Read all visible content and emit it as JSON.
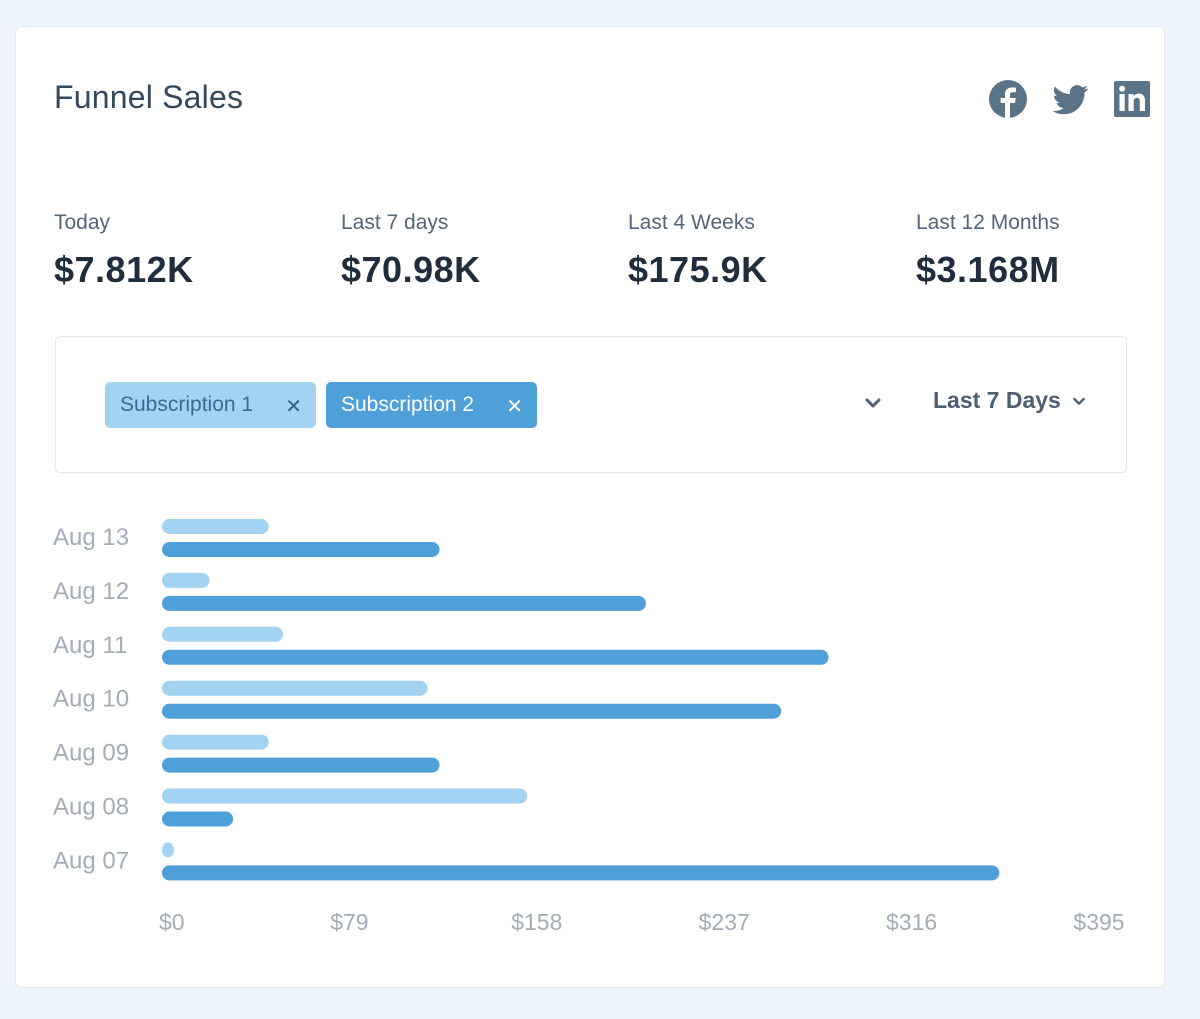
{
  "card": {
    "title": "Funnel Sales",
    "social": [
      {
        "name": "facebook-icon",
        "label": "Facebook"
      },
      {
        "name": "twitter-icon",
        "label": "Twitter"
      },
      {
        "name": "linkedin-icon",
        "label": "LinkedIn"
      }
    ],
    "icon_color": "#5a7386"
  },
  "stats": [
    {
      "label": "Today",
      "value": "$7.812K"
    },
    {
      "label": "Last 7 days",
      "value": "$70.98K"
    },
    {
      "label": "Last 4 Weeks",
      "value": "$175.9K"
    },
    {
      "label": "Last 12 Months",
      "value": "$3.168M"
    }
  ],
  "filter": {
    "tags": [
      {
        "label": "Subscription 1",
        "remove_icon": "close-icon",
        "color": "#a4d2f1"
      },
      {
        "label": "Subscription 2",
        "remove_icon": "close-icon",
        "color": "#4fa0d8"
      }
    ],
    "series_dropdown_icon": "chevron-down-icon",
    "range_label": "Last 7 Days",
    "range_icon": "chevron-down-icon"
  },
  "chart_data": {
    "type": "bar",
    "orientation": "horizontal",
    "title": "",
    "xlabel": "",
    "ylabel": "",
    "categories": [
      "Aug 13",
      "Aug 12",
      "Aug 11",
      "Aug 10",
      "Aug 09",
      "Aug 08",
      "Aug 07"
    ],
    "series": [
      {
        "name": "Subscription 1",
        "color": "#a4d2f1",
        "values": [
          45,
          20,
          51,
          112,
          45,
          154,
          5
        ]
      },
      {
        "name": "Subscription 2",
        "color": "#4fa0d8",
        "values": [
          117,
          204,
          281,
          261,
          117,
          30,
          353
        ]
      }
    ],
    "xlim": [
      0,
      395
    ],
    "xticks": [
      0,
      79,
      158,
      237,
      316,
      395
    ],
    "xtick_labels": [
      "$0",
      "$79",
      "$158",
      "$237",
      "$316",
      "$395"
    ],
    "grid": false,
    "legend": "top (as filter tags)"
  }
}
